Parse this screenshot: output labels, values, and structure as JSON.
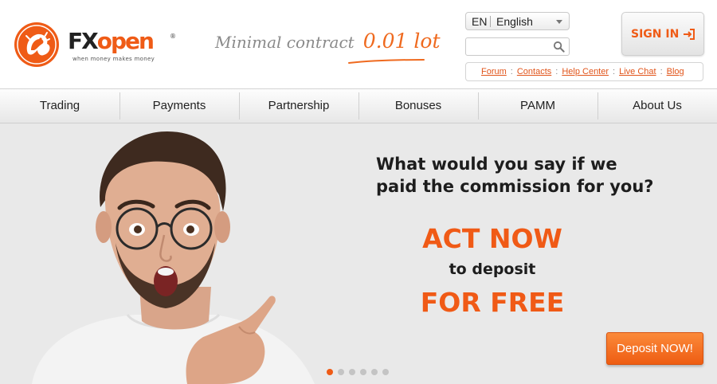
{
  "brand": {
    "name_part1": "FX",
    "name_part2": "open",
    "registered": "®",
    "tagline": "when money makes money"
  },
  "promo": {
    "text": "Minimal contract",
    "value": "0.01 lot"
  },
  "language": {
    "code": "EN",
    "name": "English"
  },
  "search": {
    "value": "",
    "placeholder": ""
  },
  "links": {
    "items": [
      "Forum",
      "Contacts",
      "Help Center",
      "Live Chat",
      "Blog"
    ],
    "separator": ":"
  },
  "signin": {
    "label": "SIGN IN"
  },
  "nav": {
    "items": [
      "Trading",
      "Payments",
      "Partnership",
      "Bonuses",
      "PAMM",
      "About Us"
    ]
  },
  "hero": {
    "headline_line1": "What would you say if we",
    "headline_line2": "paid the commission for you?",
    "act_now": "ACT NOW",
    "to_deposit": "to deposit",
    "for_free": "FOR FREE",
    "cta": "Deposit NOW!",
    "slides_total": 6,
    "active_slide": 1
  },
  "colors": {
    "accent": "#ef5b16",
    "link": "#e1541a",
    "hero_bg": "#e9e9e9",
    "text_dark": "#1d1d1d"
  },
  "icons": {
    "logo": "lion-emblem-icon",
    "search": "magnifier-icon",
    "signin": "sign-in-arrow-icon",
    "lang": "chevron-down-icon"
  }
}
